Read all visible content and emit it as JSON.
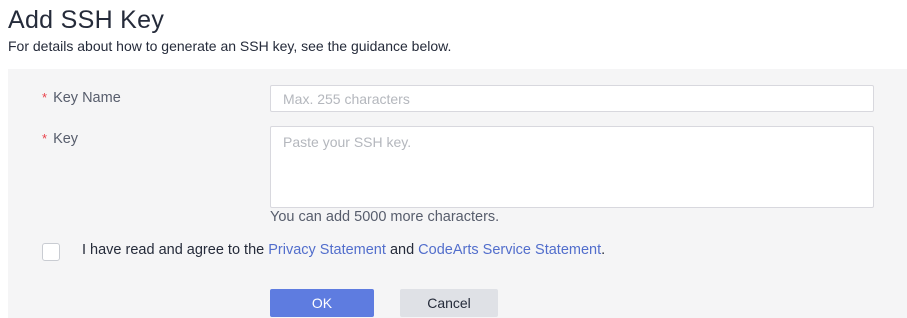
{
  "dialog": {
    "title": "Add SSH Key",
    "subtitle": "For details about how to generate an SSH key, see the guidance below."
  },
  "form": {
    "key_name": {
      "required_mark": "*",
      "label": "Key Name",
      "value": "",
      "placeholder": "Max. 255 characters"
    },
    "key": {
      "required_mark": "*",
      "label": "Key",
      "value": "",
      "placeholder": "Paste your SSH key.",
      "hint": "You can add 5000 more characters."
    },
    "agreement": {
      "checked": false,
      "text_prefix": "I have read and agree to the",
      "privacy_link": "Privacy Statement",
      "text_and": "and",
      "service_link": "CodeArts Service Statement",
      "text_suffix": "."
    }
  },
  "buttons": {
    "ok": "OK",
    "cancel": "Cancel"
  },
  "colors": {
    "primary": "#5e7ce0",
    "link": "#526ecc",
    "required": "#e9414a",
    "panel_bg": "#f5f5f6"
  }
}
